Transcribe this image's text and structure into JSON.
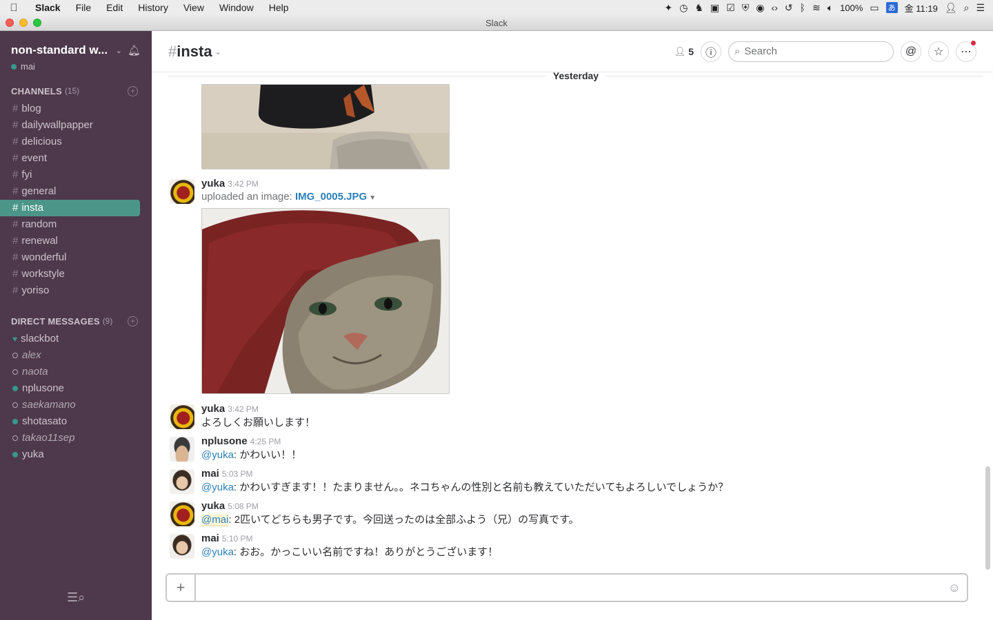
{
  "menubar": {
    "apple_icon": "",
    "app_name": "Slack",
    "items": [
      "File",
      "Edit",
      "History",
      "View",
      "Window",
      "Help"
    ],
    "battery": "100%",
    "clock": "金 11:19",
    "ime": "あ"
  },
  "window": {
    "title": "Slack"
  },
  "sidebar": {
    "team_name": "non-standard w...",
    "user": "mai",
    "channels_label": "CHANNELS",
    "channels_count": "(15)",
    "channels": [
      "blog",
      "dailywallpapper",
      "delicious",
      "event",
      "fyi",
      "general",
      "insta",
      "random",
      "renewal",
      "wonderful",
      "workstyle",
      "yoriso"
    ],
    "active_channel": "insta",
    "dm_label": "DIRECT MESSAGES",
    "dm_count": "(9)",
    "dms": [
      {
        "name": "slackbot",
        "status": "bot"
      },
      {
        "name": "alex",
        "status": "away"
      },
      {
        "name": "naota",
        "status": "away"
      },
      {
        "name": "nplusone",
        "status": "online"
      },
      {
        "name": "saekamano",
        "status": "away"
      },
      {
        "name": "shotasato",
        "status": "online"
      },
      {
        "name": "takao11sep",
        "status": "away"
      },
      {
        "name": "yuka",
        "status": "online"
      }
    ]
  },
  "header": {
    "hash": "#",
    "channel": "insta",
    "member_count": "5",
    "search_placeholder": "Search"
  },
  "feed": {
    "day_divider": "Yesterday",
    "upload": {
      "author": "yuka",
      "time": "3:42 PM",
      "prefix": "uploaded an image:",
      "filename": "IMG_0005.JPG"
    },
    "messages": [
      {
        "author": "yuka",
        "time": "3:42 PM",
        "mention": "",
        "text": "よろしくお願いします！"
      },
      {
        "author": "nplusone",
        "time": "4:25 PM",
        "mention": "@yuka",
        "text": ": かわいい！！"
      },
      {
        "author": "mai",
        "time": "5:03 PM",
        "mention": "@yuka",
        "text": ": かわいすぎます！！たまりません。。ネコちゃんの性別と名前も教えていただいてもよろしいでしょうか？"
      },
      {
        "author": "yuka",
        "time": "5:08 PM",
        "mention": "@mai",
        "text": ": 2匹いてどちらも男子です。今回送ったのは全部ふよう（兄）の写真です。"
      },
      {
        "author": "mai",
        "time": "5:10 PM",
        "mention": "@yuka",
        "text": ": おお。かっこいい名前ですね！ありがとうございます！"
      }
    ]
  },
  "colors": {
    "sidebar_bg": "#4d394b",
    "active_channel": "#4c9689",
    "presence": "#38978d",
    "link": "#2a80b9"
  }
}
